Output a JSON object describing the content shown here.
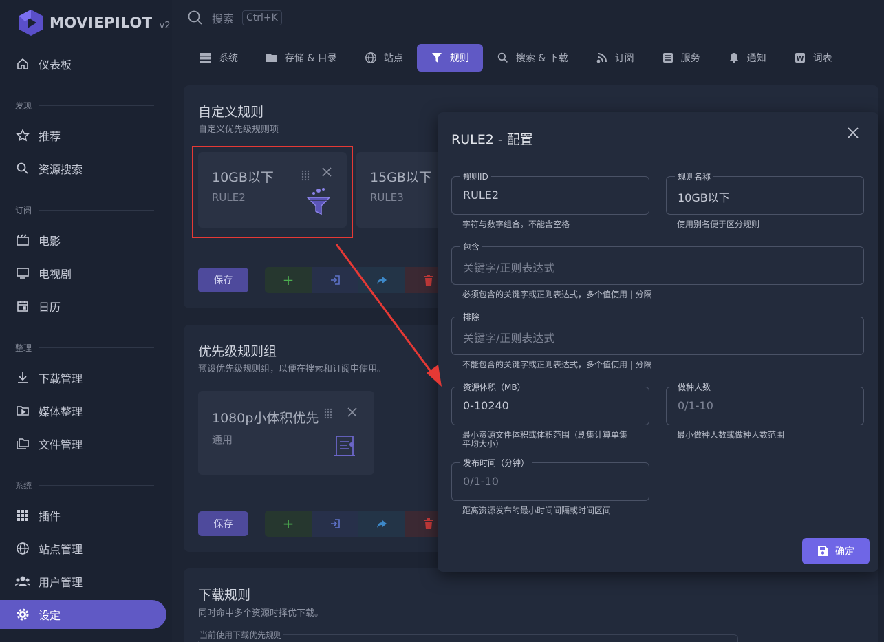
{
  "app": {
    "name": "MOVIEPILOT",
    "version": "v2"
  },
  "search": {
    "placeholder": "搜索",
    "shortcut": "Ctrl+K"
  },
  "sidebar": {
    "dashboard": "仪表板",
    "section_discover": "发现",
    "recommend": "推荐",
    "resource_search": "资源搜索",
    "section_subscribe": "订阅",
    "movies": "电影",
    "tv": "电视剧",
    "calendar": "日历",
    "section_organize": "整理",
    "download_mgmt": "下载管理",
    "media_organize": "媒体整理",
    "file_mgmt": "文件管理",
    "section_system": "系统",
    "plugins": "插件",
    "site_mgmt": "站点管理",
    "user_mgmt": "用户管理",
    "settings": "设定"
  },
  "tabs": [
    "系统",
    "存储 & 目录",
    "站点",
    "规则",
    "搜索 & 下载",
    "订阅",
    "服务",
    "通知",
    "词表"
  ],
  "custom_rules": {
    "title": "自定义规则",
    "subtitle": "自定义优先级规则项",
    "cards": [
      {
        "name": "10GB以下",
        "id": "RULE2"
      },
      {
        "name": "15GB以下",
        "id": "RULE3"
      }
    ],
    "save": "保存"
  },
  "priority_groups": {
    "title": "优先级规则组",
    "subtitle": "预设优先级规则组，以便在搜索和订阅中使用。",
    "cards": [
      {
        "name": "1080p小体积优先",
        "id": "通用"
      }
    ],
    "save": "保存"
  },
  "download_rules": {
    "title": "下载规则",
    "subtitle": "同时命中多个资源时择优下载。",
    "legend": "当前使用下载优先规则"
  },
  "dialog": {
    "title": "RULE2 - 配置",
    "rule_id": {
      "label": "规则ID",
      "value": "RULE2",
      "hint": "字符与数字组合，不能含空格"
    },
    "rule_name": {
      "label": "规则名称",
      "value": "10GB以下",
      "hint": "使用别名便于区分规则"
    },
    "include": {
      "label": "包含",
      "placeholder": "关键字/正则表达式",
      "hint": "必须包含的关键字或正则表达式，多个值使用 | 分隔"
    },
    "exclude": {
      "label": "排除",
      "placeholder": "关键字/正则表达式",
      "hint": "不能包含的关键字或正则表达式，多个值使用 | 分隔"
    },
    "size": {
      "label": "资源体积（MB）",
      "value": "0-10240",
      "hint_line1": "最小资源文件体积或体积范围（剧集计算单集",
      "hint_line2": "平均大小）"
    },
    "seeders": {
      "label": "做种人数",
      "placeholder": "0/1-10",
      "hint": "最小做种人数或做种人数范围"
    },
    "publish_time": {
      "label": "发布时间（分钟）",
      "placeholder": "0/1-10",
      "hint": "距离资源发布的最小时间间隔或时间区间"
    },
    "confirm": "确定"
  },
  "colors": {
    "accent": "#6059c5",
    "highlight": "#e53935"
  }
}
